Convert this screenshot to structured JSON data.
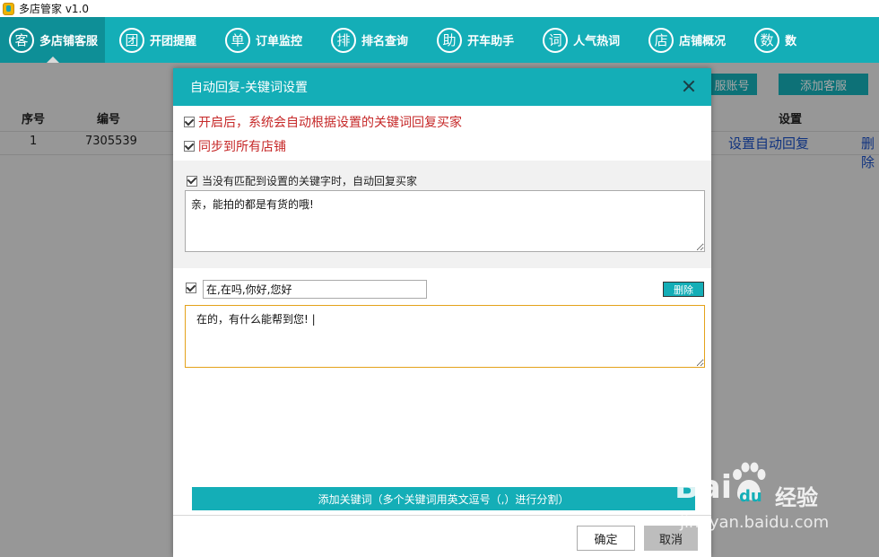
{
  "window": {
    "title": "多店管家 v1.0"
  },
  "nav": {
    "items": [
      {
        "glyph": "客",
        "label": "多店铺客服",
        "active": true
      },
      {
        "glyph": "团",
        "label": "开团提醒"
      },
      {
        "glyph": "单",
        "label": "订单监控"
      },
      {
        "glyph": "排",
        "label": "排名查询"
      },
      {
        "glyph": "助",
        "label": "开车助手"
      },
      {
        "glyph": "词",
        "label": "人气热词"
      },
      {
        "glyph": "店",
        "label": "店铺概况"
      },
      {
        "glyph": "数",
        "label": "数"
      }
    ]
  },
  "background": {
    "btn_account": "服账号",
    "btn_add_service": "添加客服",
    "table_headers": {
      "index": "序号",
      "code": "编号",
      "settings": "设置"
    },
    "row": {
      "index": "1",
      "code": "7305539",
      "settings_link": "设置自动回复",
      "delete_link": "删除"
    }
  },
  "dialog": {
    "title": "自动回复-关键词设置",
    "option_enable": "开启后，系统会自动根据设置的关键词回复买家",
    "option_sync": "同步到所有店铺",
    "default_reply_label": "当没有匹配到设置的关键字时，自动回复买家",
    "default_reply_text": "亲，能拍的都是有货的哦!",
    "keyword_value": "在,在吗,你好,您好",
    "keyword_reply_text": "在的，有什么能帮到您! |",
    "delete_label": "删除",
    "add_keyword_label": "添加关键词（多个关键词用英文逗号（,）进行分割）",
    "ok_label": "确定",
    "cancel_label": "取消"
  },
  "watermark": {
    "brand": "Bai",
    "brand_suffix": "du",
    "sub": "经验",
    "url": "jingyan.baidu.com"
  },
  "colors": {
    "accent": "#14aeb7",
    "accent_dark": "#0e8f97",
    "warning_text": "#c62828",
    "focus_border": "#e4a21b"
  }
}
